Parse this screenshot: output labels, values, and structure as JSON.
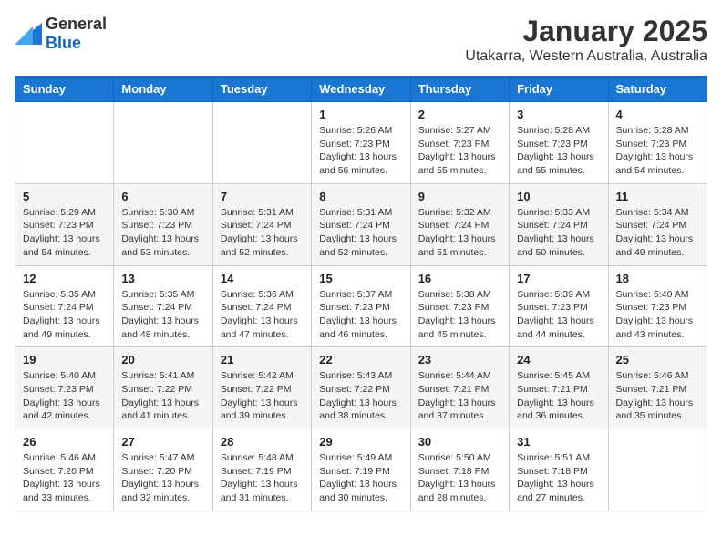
{
  "logo": {
    "general": "General",
    "blue": "Blue"
  },
  "title": "January 2025",
  "location": "Utakarra, Western Australia, Australia",
  "days_of_week": [
    "Sunday",
    "Monday",
    "Tuesday",
    "Wednesday",
    "Thursday",
    "Friday",
    "Saturday"
  ],
  "weeks": [
    [
      {
        "day": "",
        "sunrise": "",
        "sunset": "",
        "daylight": ""
      },
      {
        "day": "",
        "sunrise": "",
        "sunset": "",
        "daylight": ""
      },
      {
        "day": "",
        "sunrise": "",
        "sunset": "",
        "daylight": ""
      },
      {
        "day": "1",
        "sunrise": "Sunrise: 5:26 AM",
        "sunset": "Sunset: 7:23 PM",
        "daylight": "Daylight: 13 hours and 56 minutes."
      },
      {
        "day": "2",
        "sunrise": "Sunrise: 5:27 AM",
        "sunset": "Sunset: 7:23 PM",
        "daylight": "Daylight: 13 hours and 55 minutes."
      },
      {
        "day": "3",
        "sunrise": "Sunrise: 5:28 AM",
        "sunset": "Sunset: 7:23 PM",
        "daylight": "Daylight: 13 hours and 55 minutes."
      },
      {
        "day": "4",
        "sunrise": "Sunrise: 5:28 AM",
        "sunset": "Sunset: 7:23 PM",
        "daylight": "Daylight: 13 hours and 54 minutes."
      }
    ],
    [
      {
        "day": "5",
        "sunrise": "Sunrise: 5:29 AM",
        "sunset": "Sunset: 7:23 PM",
        "daylight": "Daylight: 13 hours and 54 minutes."
      },
      {
        "day": "6",
        "sunrise": "Sunrise: 5:30 AM",
        "sunset": "Sunset: 7:23 PM",
        "daylight": "Daylight: 13 hours and 53 minutes."
      },
      {
        "day": "7",
        "sunrise": "Sunrise: 5:31 AM",
        "sunset": "Sunset: 7:24 PM",
        "daylight": "Daylight: 13 hours and 52 minutes."
      },
      {
        "day": "8",
        "sunrise": "Sunrise: 5:31 AM",
        "sunset": "Sunset: 7:24 PM",
        "daylight": "Daylight: 13 hours and 52 minutes."
      },
      {
        "day": "9",
        "sunrise": "Sunrise: 5:32 AM",
        "sunset": "Sunset: 7:24 PM",
        "daylight": "Daylight: 13 hours and 51 minutes."
      },
      {
        "day": "10",
        "sunrise": "Sunrise: 5:33 AM",
        "sunset": "Sunset: 7:24 PM",
        "daylight": "Daylight: 13 hours and 50 minutes."
      },
      {
        "day": "11",
        "sunrise": "Sunrise: 5:34 AM",
        "sunset": "Sunset: 7:24 PM",
        "daylight": "Daylight: 13 hours and 49 minutes."
      }
    ],
    [
      {
        "day": "12",
        "sunrise": "Sunrise: 5:35 AM",
        "sunset": "Sunset: 7:24 PM",
        "daylight": "Daylight: 13 hours and 49 minutes."
      },
      {
        "day": "13",
        "sunrise": "Sunrise: 5:35 AM",
        "sunset": "Sunset: 7:24 PM",
        "daylight": "Daylight: 13 hours and 48 minutes."
      },
      {
        "day": "14",
        "sunrise": "Sunrise: 5:36 AM",
        "sunset": "Sunset: 7:24 PM",
        "daylight": "Daylight: 13 hours and 47 minutes."
      },
      {
        "day": "15",
        "sunrise": "Sunrise: 5:37 AM",
        "sunset": "Sunset: 7:23 PM",
        "daylight": "Daylight: 13 hours and 46 minutes."
      },
      {
        "day": "16",
        "sunrise": "Sunrise: 5:38 AM",
        "sunset": "Sunset: 7:23 PM",
        "daylight": "Daylight: 13 hours and 45 minutes."
      },
      {
        "day": "17",
        "sunrise": "Sunrise: 5:39 AM",
        "sunset": "Sunset: 7:23 PM",
        "daylight": "Daylight: 13 hours and 44 minutes."
      },
      {
        "day": "18",
        "sunrise": "Sunrise: 5:40 AM",
        "sunset": "Sunset: 7:23 PM",
        "daylight": "Daylight: 13 hours and 43 minutes."
      }
    ],
    [
      {
        "day": "19",
        "sunrise": "Sunrise: 5:40 AM",
        "sunset": "Sunset: 7:23 PM",
        "daylight": "Daylight: 13 hours and 42 minutes."
      },
      {
        "day": "20",
        "sunrise": "Sunrise: 5:41 AM",
        "sunset": "Sunset: 7:22 PM",
        "daylight": "Daylight: 13 hours and 41 minutes."
      },
      {
        "day": "21",
        "sunrise": "Sunrise: 5:42 AM",
        "sunset": "Sunset: 7:22 PM",
        "daylight": "Daylight: 13 hours and 39 minutes."
      },
      {
        "day": "22",
        "sunrise": "Sunrise: 5:43 AM",
        "sunset": "Sunset: 7:22 PM",
        "daylight": "Daylight: 13 hours and 38 minutes."
      },
      {
        "day": "23",
        "sunrise": "Sunrise: 5:44 AM",
        "sunset": "Sunset: 7:21 PM",
        "daylight": "Daylight: 13 hours and 37 minutes."
      },
      {
        "day": "24",
        "sunrise": "Sunrise: 5:45 AM",
        "sunset": "Sunset: 7:21 PM",
        "daylight": "Daylight: 13 hours and 36 minutes."
      },
      {
        "day": "25",
        "sunrise": "Sunrise: 5:46 AM",
        "sunset": "Sunset: 7:21 PM",
        "daylight": "Daylight: 13 hours and 35 minutes."
      }
    ],
    [
      {
        "day": "26",
        "sunrise": "Sunrise: 5:46 AM",
        "sunset": "Sunset: 7:20 PM",
        "daylight": "Daylight: 13 hours and 33 minutes."
      },
      {
        "day": "27",
        "sunrise": "Sunrise: 5:47 AM",
        "sunset": "Sunset: 7:20 PM",
        "daylight": "Daylight: 13 hours and 32 minutes."
      },
      {
        "day": "28",
        "sunrise": "Sunrise: 5:48 AM",
        "sunset": "Sunset: 7:19 PM",
        "daylight": "Daylight: 13 hours and 31 minutes."
      },
      {
        "day": "29",
        "sunrise": "Sunrise: 5:49 AM",
        "sunset": "Sunset: 7:19 PM",
        "daylight": "Daylight: 13 hours and 30 minutes."
      },
      {
        "day": "30",
        "sunrise": "Sunrise: 5:50 AM",
        "sunset": "Sunset: 7:18 PM",
        "daylight": "Daylight: 13 hours and 28 minutes."
      },
      {
        "day": "31",
        "sunrise": "Sunrise: 5:51 AM",
        "sunset": "Sunset: 7:18 PM",
        "daylight": "Daylight: 13 hours and 27 minutes."
      },
      {
        "day": "",
        "sunrise": "",
        "sunset": "",
        "daylight": ""
      }
    ]
  ]
}
